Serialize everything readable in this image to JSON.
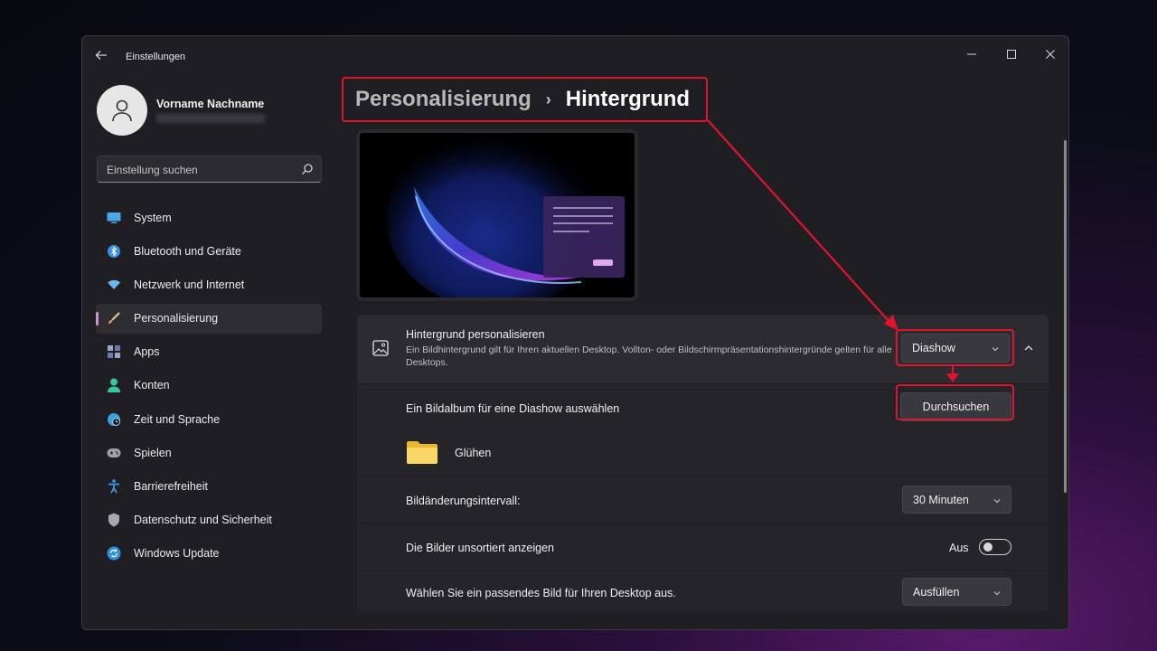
{
  "window": {
    "title": "Einstellungen",
    "controls": {
      "minimize": "minimize-icon",
      "maximize": "maximize-icon",
      "close": "close-icon"
    }
  },
  "user": {
    "name": "Vorname Nachname"
  },
  "search": {
    "placeholder": "Einstellung suchen"
  },
  "nav": {
    "items": [
      {
        "label": "System",
        "icon": "monitor-icon",
        "color": "#4aa8e8"
      },
      {
        "label": "Bluetooth und Geräte",
        "icon": "bluetooth-icon",
        "color": "#3b8fe0"
      },
      {
        "label": "Netzwerk und Internet",
        "icon": "wifi-icon",
        "color": "#6bb6ea"
      },
      {
        "label": "Personalisierung",
        "icon": "brush-icon",
        "color": "#e8a060",
        "active": true
      },
      {
        "label": "Apps",
        "icon": "apps-icon",
        "color": "#9aa6c8"
      },
      {
        "label": "Konten",
        "icon": "person-icon",
        "color": "#35c7a0"
      },
      {
        "label": "Zeit und Sprache",
        "icon": "globe-clock-icon",
        "color": "#3aa0e0"
      },
      {
        "label": "Spielen",
        "icon": "gamepad-icon",
        "color": "#a0a0a8"
      },
      {
        "label": "Barrierefreiheit",
        "icon": "accessibility-icon",
        "color": "#3a9ae8"
      },
      {
        "label": "Datenschutz und Sicherheit",
        "icon": "shield-icon",
        "color": "#a8a8b0"
      },
      {
        "label": "Windows Update",
        "icon": "update-icon",
        "color": "#2f8fe0"
      }
    ]
  },
  "breadcrumb": {
    "parent": "Personalisierung",
    "separator": "›",
    "current": "Hintergrund"
  },
  "background": {
    "title": "Hintergrund personalisieren",
    "description": "Ein Bildhintergrund gilt für Ihren aktuellen Desktop. Vollton- oder Bildschirmpräsentationshintergründe gelten für alle Desktops.",
    "type_value": "Diashow",
    "album_label": "Ein Bildalbum für eine Diashow auswählen",
    "browse_label": "Durchsuchen",
    "folder_name": "Glühen",
    "interval_label": "Bildänderungsintervall:",
    "interval_value": "30 Minuten",
    "shuffle_label": "Die Bilder unsortiert anzeigen",
    "shuffle_state": "Aus",
    "fit_label": "Wählen Sie ein passendes Bild für Ihren Desktop aus.",
    "fit_value": "Ausfüllen"
  },
  "colors": {
    "accent": "#d68ed8",
    "highlight": "#e0142c",
    "window_bg": "#1f1f23",
    "card_bg": "#2b2b30"
  }
}
